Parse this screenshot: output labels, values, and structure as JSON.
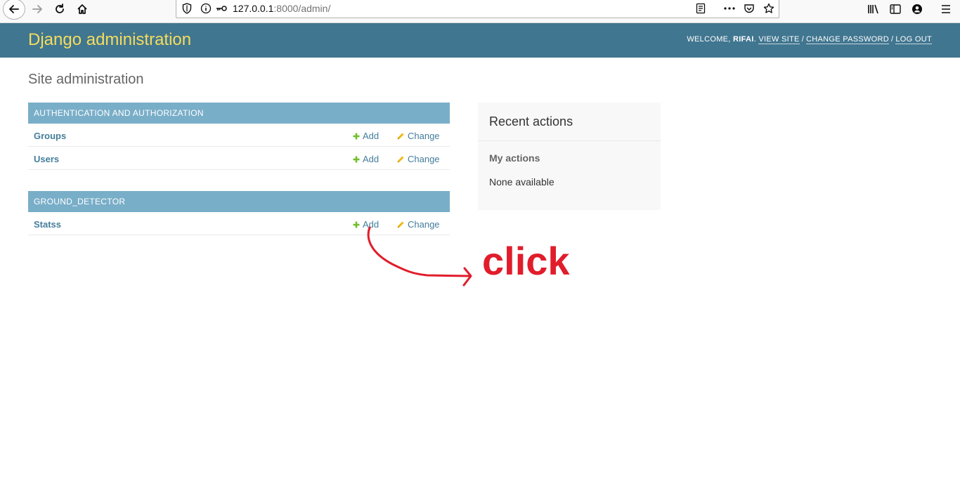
{
  "browser": {
    "url_host": "127.0.0.1",
    "url_rest": ":8000/admin/"
  },
  "header": {
    "branding": "Django administration",
    "welcome": "WELCOME, ",
    "username": "RIFAI",
    "welcome_end": ".",
    "view_site": "VIEW SITE",
    "change_password": "CHANGE PASSWORD",
    "log_out": "LOG OUT",
    "separator": "/"
  },
  "page": {
    "title": "Site administration"
  },
  "apps": [
    {
      "caption": "Authentication and Authorization",
      "models": [
        {
          "name": "Groups",
          "add": "Add",
          "change": "Change"
        },
        {
          "name": "Users",
          "add": "Add",
          "change": "Change"
        }
      ]
    },
    {
      "caption": "Ground_detector",
      "models": [
        {
          "name": "Statss",
          "add": "Add",
          "change": "Change"
        }
      ]
    }
  ],
  "recent": {
    "title": "Recent actions",
    "my_actions": "My actions",
    "none": "None available"
  },
  "annotation": {
    "text": "click"
  },
  "colors": {
    "header_bg": "#417690",
    "branding": "#f5dd5d",
    "caption_bg": "#79aec8",
    "link": "#447e9b",
    "add_icon": "#70bf2b",
    "change_icon": "#efb80b",
    "annotation": "#e11d2b"
  }
}
